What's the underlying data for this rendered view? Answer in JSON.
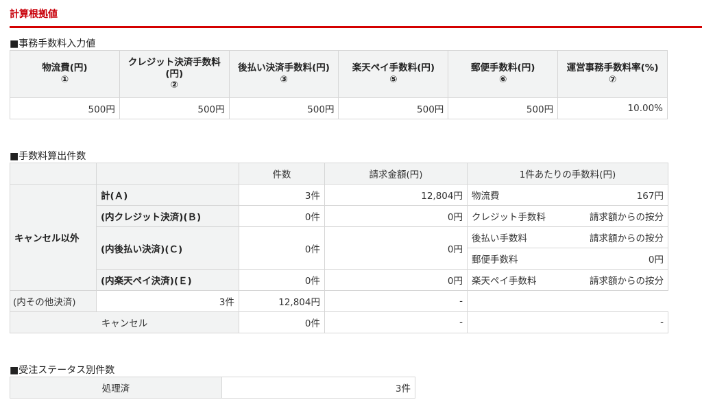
{
  "title": "計算根拠値",
  "fees": {
    "section": "■事務手数料入力値",
    "headers": [
      [
        "物流費(円)",
        "①"
      ],
      [
        "クレジット決済手数料(円)",
        "②"
      ],
      [
        "後払い決済手数料(円)",
        "③"
      ],
      [
        "楽天ペイ手数料(円)",
        "⑤"
      ],
      [
        "郵便手数料(円)",
        "⑥"
      ],
      [
        "運営事務手数料率(%)",
        "⑦"
      ]
    ],
    "values": [
      "500円",
      "500円",
      "500円",
      "500円",
      "500円",
      "10.00%"
    ]
  },
  "counts": {
    "section": "■手数料算出件数",
    "headers": {
      "count": "件数",
      "amount": "請求金額(円)",
      "per": "1件あたりの手数料(円)"
    },
    "group": "キャンセル以外",
    "rows": [
      {
        "label": "計(Ａ)",
        "count": "3件",
        "amount": "12,804円",
        "fee_label": "物流費",
        "fee_value": "167円"
      },
      {
        "label": "(内クレジット決済)(Ｂ)",
        "count": "0件",
        "amount": "0円",
        "fee_label": "クレジット手数料",
        "fee_value": "請求額からの按分"
      },
      {
        "label": "(内後払い決済)(Ｃ)",
        "count": "0件",
        "amount": "0円",
        "fee_label": "後払い手数料",
        "fee_value": "請求額からの按分",
        "fee2_label": "郵便手数料",
        "fee2_value": "0円"
      },
      {
        "label": "(内楽天ペイ決済)(Ｅ)",
        "count": "0件",
        "amount": "0円",
        "fee_label": "楽天ペイ手数料",
        "fee_value": "請求額からの按分"
      }
    ],
    "other": {
      "label": "(内その他決済)",
      "count": "3件",
      "amount": "12,804円",
      "dash": "-"
    },
    "cancel": {
      "label": "キャンセル",
      "count": "0件",
      "amount": "-",
      "fee": "-"
    }
  },
  "status": {
    "section": "■受注ステータス別件数",
    "rows": [
      {
        "label": "処理済",
        "count": "3件"
      }
    ]
  }
}
